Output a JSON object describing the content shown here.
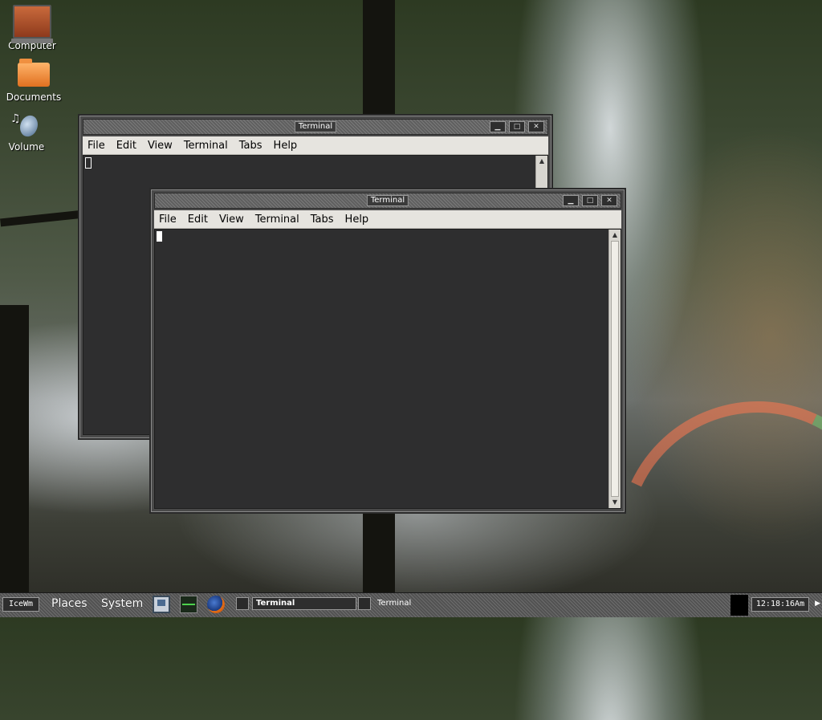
{
  "desktop": {
    "icons": [
      {
        "label": "Computer",
        "icon": "computer-icon"
      },
      {
        "label": "Documents",
        "icon": "folder-icon"
      },
      {
        "label": "Volume",
        "icon": "speaker-volume-icon"
      }
    ]
  },
  "windows": [
    {
      "title": "Terminal",
      "menu": [
        "File",
        "Edit",
        "View",
        "Terminal",
        "Tabs",
        "Help"
      ],
      "buttons": [
        "minimize",
        "maximize",
        "close"
      ]
    },
    {
      "title": "Terminal",
      "menu": [
        "File",
        "Edit",
        "View",
        "Terminal",
        "Tabs",
        "Help"
      ],
      "buttons": [
        "minimize",
        "maximize",
        "close"
      ]
    }
  ],
  "taskbar": {
    "start_label": "IceWm",
    "places_label": "Places",
    "system_label": "System",
    "launchers": [
      "monitor-icon",
      "system-monitor-icon",
      "firefox-icon"
    ],
    "tasks": [
      {
        "label": "Terminal",
        "active": true
      },
      {
        "label": "Terminal",
        "active": false
      }
    ],
    "clock": "12:18:16Am"
  }
}
